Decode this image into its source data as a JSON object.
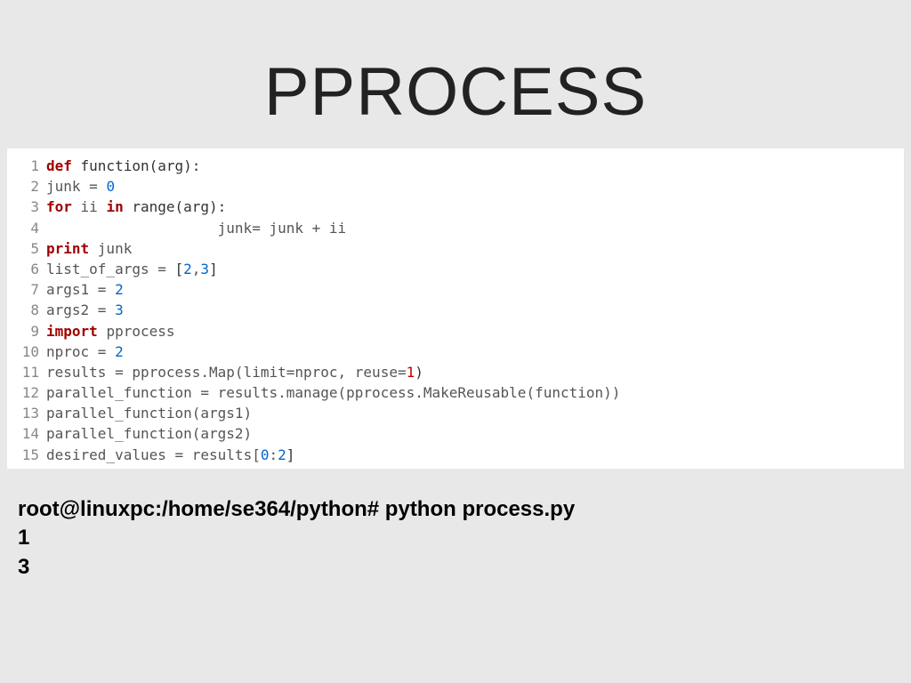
{
  "title": "PPROCESS",
  "code": {
    "lines": [
      {
        "n": "1",
        "tokens": [
          {
            "t": "def ",
            "c": "kw"
          },
          {
            "t": "function(arg):",
            "c": "fn"
          }
        ]
      },
      {
        "n": "2",
        "tokens": [
          {
            "t": "junk ",
            "c": "nm"
          },
          {
            "t": "= ",
            "c": "op"
          },
          {
            "t": "0",
            "c": "num"
          }
        ]
      },
      {
        "n": "3",
        "tokens": [
          {
            "t": "for ",
            "c": "kw"
          },
          {
            "t": "ii ",
            "c": "nm"
          },
          {
            "t": "in ",
            "c": "kw"
          },
          {
            "t": "range(arg):",
            "c": "fn"
          }
        ]
      },
      {
        "n": "4",
        "tokens": [
          {
            "t": "                    junk= junk + ii",
            "c": "nm"
          }
        ]
      },
      {
        "n": "5",
        "tokens": [
          {
            "t": "print ",
            "c": "kw"
          },
          {
            "t": "junk",
            "c": "nm"
          }
        ]
      },
      {
        "n": "6",
        "tokens": [
          {
            "t": "list_of_args ",
            "c": "nm"
          },
          {
            "t": "= ",
            "c": "op"
          },
          {
            "t": "[",
            "c": "br"
          },
          {
            "t": "2",
            "c": "num"
          },
          {
            "t": ",",
            "c": "op"
          },
          {
            "t": "3",
            "c": "num"
          },
          {
            "t": "]",
            "c": "br"
          }
        ]
      },
      {
        "n": "7",
        "tokens": [
          {
            "t": "args1 ",
            "c": "nm"
          },
          {
            "t": "= ",
            "c": "op"
          },
          {
            "t": "2",
            "c": "num"
          }
        ]
      },
      {
        "n": "8",
        "tokens": [
          {
            "t": "args2 ",
            "c": "nm"
          },
          {
            "t": "= ",
            "c": "op"
          },
          {
            "t": "3",
            "c": "num"
          }
        ]
      },
      {
        "n": "9",
        "tokens": [
          {
            "t": "import ",
            "c": "kw"
          },
          {
            "t": "pprocess",
            "c": "nm"
          }
        ]
      },
      {
        "n": "10",
        "tokens": [
          {
            "t": "nproc ",
            "c": "nm"
          },
          {
            "t": "= ",
            "c": "op"
          },
          {
            "t": "2",
            "c": "num"
          }
        ]
      },
      {
        "n": "11",
        "tokens": [
          {
            "t": "results ",
            "c": "nm"
          },
          {
            "t": "= ",
            "c": "op"
          },
          {
            "t": "pprocess.Map(limit",
            "c": "nm"
          },
          {
            "t": "=",
            "c": "op"
          },
          {
            "t": "nproc, reuse",
            "c": "nm"
          },
          {
            "t": "=",
            "c": "op"
          },
          {
            "t": "1",
            "c": "num1"
          },
          {
            "t": ")",
            "c": "par"
          }
        ]
      },
      {
        "n": "12",
        "tokens": [
          {
            "t": "parallel_function ",
            "c": "nm"
          },
          {
            "t": "= ",
            "c": "op"
          },
          {
            "t": "results.manage(pprocess.MakeReusable(function))",
            "c": "nm"
          }
        ]
      },
      {
        "n": "13",
        "tokens": [
          {
            "t": "parallel_function(args1)",
            "c": "nm"
          }
        ]
      },
      {
        "n": "14",
        "tokens": [
          {
            "t": "parallel_function(args2)",
            "c": "nm"
          }
        ]
      },
      {
        "n": "15",
        "tokens": [
          {
            "t": "desired_values ",
            "c": "nm"
          },
          {
            "t": "= ",
            "c": "op"
          },
          {
            "t": "results[",
            "c": "nm"
          },
          {
            "t": "0",
            "c": "num"
          },
          {
            "t": ":",
            "c": "op"
          },
          {
            "t": "2",
            "c": "num"
          },
          {
            "t": "]",
            "c": "br"
          }
        ]
      }
    ]
  },
  "terminal": {
    "lines": [
      "root@linuxpc:/home/se364/python# python process.py",
      "1",
      "3"
    ]
  }
}
